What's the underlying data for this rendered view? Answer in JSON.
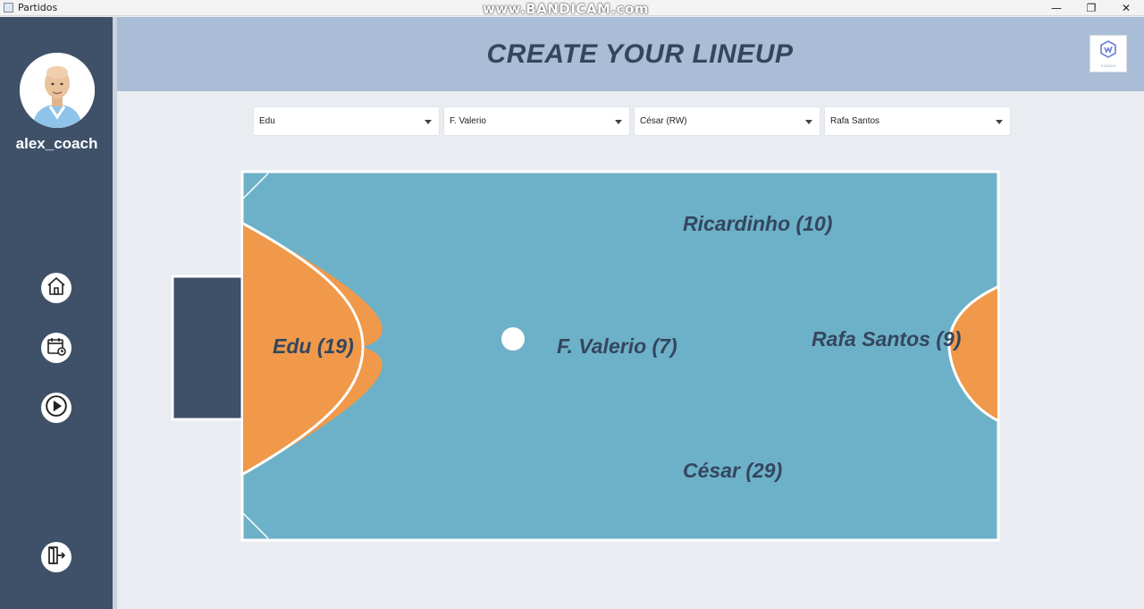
{
  "window": {
    "title": "Partidos",
    "watermark": "www.BANDICAM.com",
    "controls": {
      "minimize": "—",
      "maximize": "❐",
      "close": "✕"
    }
  },
  "sidebar": {
    "username": "alex_coach",
    "nav": [
      {
        "name": "home-icon"
      },
      {
        "name": "calendar-icon"
      },
      {
        "name": "play-icon"
      },
      {
        "name": "logout-icon"
      }
    ]
  },
  "header": {
    "title": "CREATE YOUR LINEUP",
    "logo_text": "COACH"
  },
  "selectors": [
    {
      "value": "Edu"
    },
    {
      "value": "F. Valerio"
    },
    {
      "value": "César (RW)"
    },
    {
      "value": "Rafa Santos"
    }
  ],
  "court": {
    "colors": {
      "field": "#6db1c8",
      "area": "#f0994a",
      "goal": "#3f5169",
      "lines": "#ffffff"
    },
    "players": {
      "goalkeeper": "Edu (19)",
      "center": "F. Valerio (7)",
      "top": "Ricardinho (10)",
      "bottom": "César (29)",
      "pivot": "Rafa Santos (9)"
    }
  },
  "colors": {
    "sidebar": "#3f5169",
    "header": "#a9bdd6",
    "title": "#34465e",
    "background": "#e9edf1"
  }
}
